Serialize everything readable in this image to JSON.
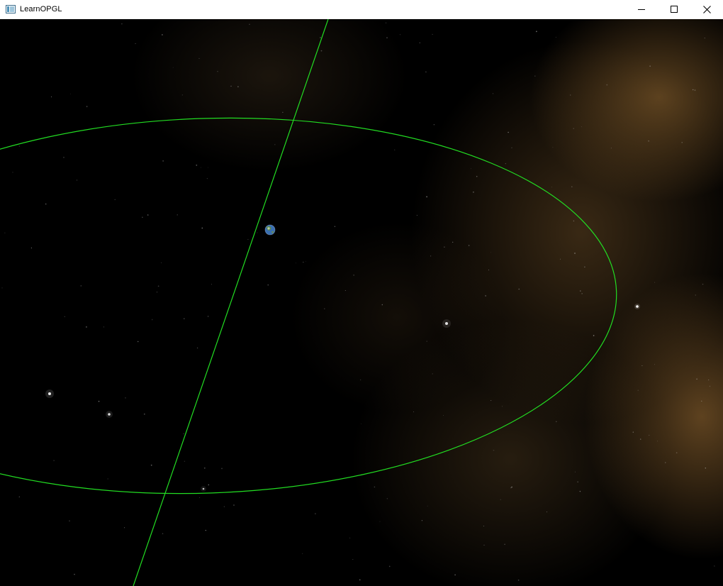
{
  "window": {
    "title": "LearnOPGL"
  },
  "icons": {
    "app": "app-window-icon",
    "minimize": "minimize-icon",
    "maximize": "maximize-icon",
    "close": "close-icon"
  },
  "colors": {
    "orbit": "#22dd22",
    "space": "#000000",
    "nebula": "#7a5528",
    "planet": "#3a6fb0"
  }
}
